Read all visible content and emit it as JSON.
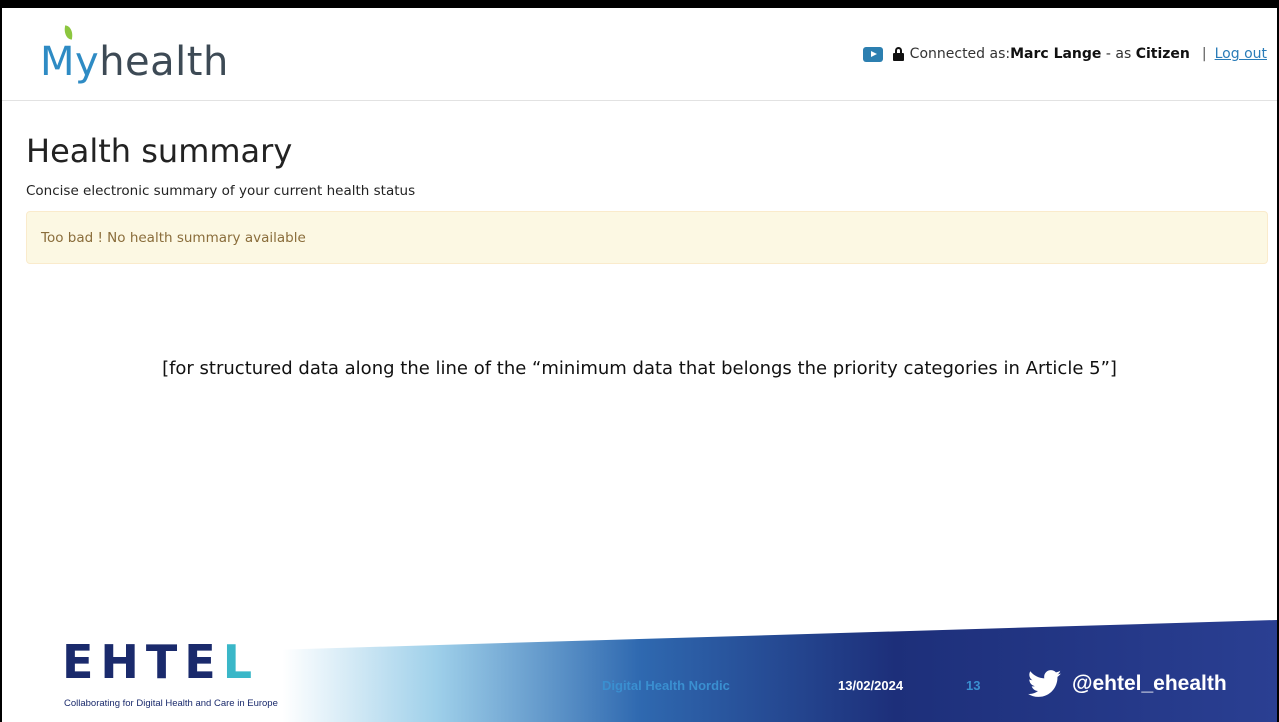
{
  "header": {
    "logo_my": "My",
    "logo_health": "health",
    "connected_prefix": "Connected as: ",
    "user_name": "Marc Lange",
    "as_text": " - as ",
    "role": "Citizen",
    "separator": "|",
    "logout_label": "Log out"
  },
  "main": {
    "title": "Health summary",
    "subtitle": "Concise electronic summary of your current health status",
    "alert_text": "Too bad ! No health summary available"
  },
  "annotation": "[for structured data along the line of the “minimum data that belongs the priority categories in Article 5”]",
  "footer": {
    "logo_text_e": "EHTE",
    "logo_text_l": "L",
    "tagline": "Collaborating for Digital Health and Care in Europe",
    "event": "Digital Health Nordic",
    "date": "13/02/2024",
    "page_number": "13",
    "twitter_handle": "@ehtel_ehealth"
  },
  "colors": {
    "accent_blue": "#2a7cb8",
    "alert_bg": "#fcf8e3",
    "alert_text": "#8a6d3b",
    "footer_navy": "#1d2f7a",
    "footer_light": "#5aa9d8"
  },
  "icons": [
    "youtube-icon",
    "lock-icon",
    "twitter-icon"
  ]
}
